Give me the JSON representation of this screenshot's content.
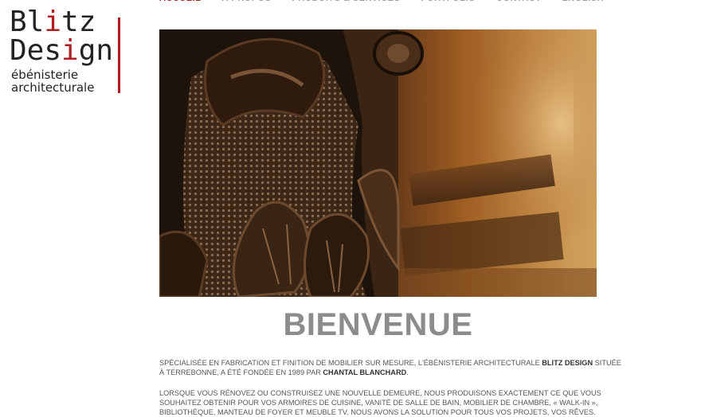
{
  "logo": {
    "word1_pre": "Bl",
    "word1_red": "i",
    "word1_post": "tz",
    "word2_pre": "Des",
    "word2_red": "i",
    "word2_post": "gn",
    "tagline1": "ébénisterie",
    "tagline2": "architecturale"
  },
  "nav": [
    {
      "label": "ACCUEIL",
      "active": true
    },
    {
      "label": "À PROPOS"
    },
    {
      "label": "PRODUITS & SERVICES"
    },
    {
      "label": "PORTFOLIO"
    },
    {
      "label": "CONTACT"
    },
    {
      "label": "ENGLISH"
    }
  ],
  "colors": {
    "accent": "#b01c20",
    "nav_inactive": "#9a9a9a",
    "title": "#8c8c8c"
  },
  "main": {
    "title": "BIENVENUE",
    "p1_a": "Spécialisée en fabrication et finition de mobilier sur mesure, l'ébénisterie architecturale ",
    "p1_brand": "Blitz Design",
    "p1_b": " située à Terrebonne, a été fondée en 1989 par ",
    "p1_founder": "Chantal Blanchard",
    "p1_c": ".",
    "p2": "Lorsque vous rénovez ou construisez une nouvelle demeure, nous produisons exactement ce que vous souhaitez obtenir pour vos armoires de cuisine, vanité de salle de bain, mobilier de chambre, « walk-in », bibliothèque, manteau de foyer et meuble TV. Nous avons la solution pour tous vos projets, vos rêves."
  }
}
